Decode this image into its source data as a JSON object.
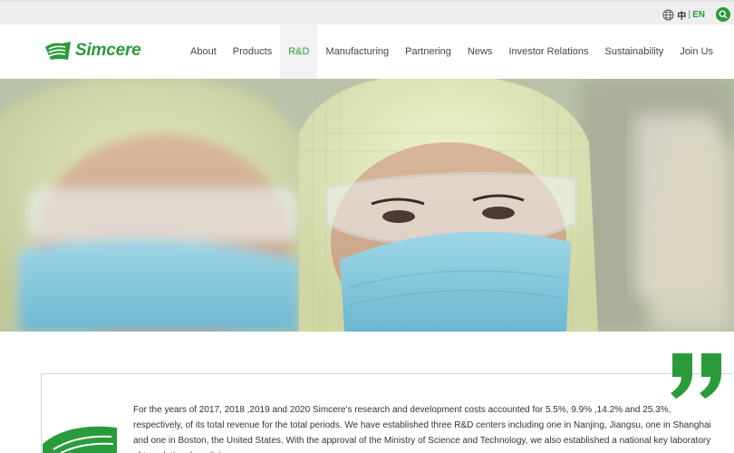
{
  "topbar": {
    "lang_zh": "中",
    "lang_sep": "|",
    "lang_en": "EN"
  },
  "header": {
    "logo_text": "Simcere",
    "nav": [
      {
        "label": "About"
      },
      {
        "label": "Products"
      },
      {
        "label": "R&D"
      },
      {
        "label": "Manufacturing"
      },
      {
        "label": "Partnering"
      },
      {
        "label": "News"
      },
      {
        "label": "Investor Relations"
      },
      {
        "label": "Sustainability"
      },
      {
        "label": "Join Us"
      }
    ],
    "active_index": 2
  },
  "intro": {
    "text": "For the years of 2017, 2018 ,2019 and 2020 Simcere's research and development costs accounted for 5.5%, 9.9% ,14.2% and 25.3%, respectively, of its total revenue for the total periods. We have established three R&D centers including one in Nanjing, Jiangsu, one in Shanghai and one in Boston, the United States. With the approval of the Ministry of Science and Technology, we also established a national key laboratory of translational medicine"
  },
  "colors": {
    "brand_green": "#2a9b3a",
    "topbar_bg": "#eeeeee"
  },
  "icons": [
    "globe-icon",
    "search-icon",
    "simcere-logo-icon",
    "quote-mark-icon"
  ]
}
